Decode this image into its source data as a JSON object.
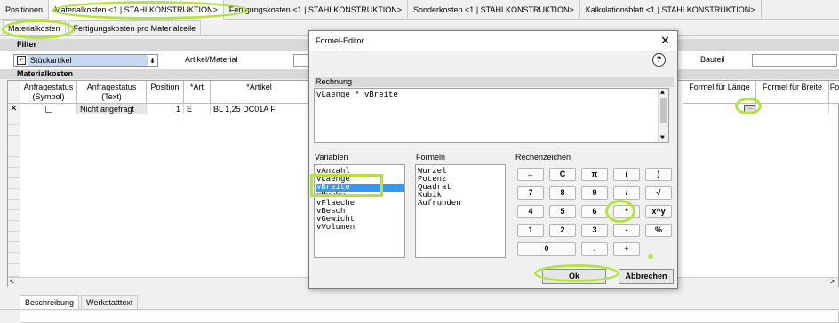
{
  "top_tabs": [
    "Positionen",
    "Materialkosten <1 | STAHLKONSTRUKTION>",
    "Fertigungskosten <1 | STAHLKONSTRUKTION>",
    "Sonderkosten <1 | STAHLKONSTRUKTION>",
    "Kalkulationsblatt <1 | STAHLKONSTRUKTION>"
  ],
  "sub_tabs": [
    "Materialkosten",
    "Fertigungskosten pro Materialzeile"
  ],
  "filter": {
    "title": "Filter",
    "select_value": "Stückartikel",
    "artikel_label": "Artikel/Material",
    "bauteil_label": "Bauteil"
  },
  "section_title": "Materialkosten",
  "grid": {
    "headers": [
      "Anfragestatus\n(Symbol)",
      "Anfragestatus\n(Text)",
      "Position",
      "*Art",
      "*Artikel",
      "Formel für Länge",
      "Formel für Breite",
      "Fo"
    ],
    "row": {
      "marker": "✕",
      "status_text": "Nicht angefragt",
      "position": "1",
      "art": "E",
      "artikel": "BL 1,25 DC01A F"
    },
    "scroll_left": "<",
    "scroll_right": ">"
  },
  "bottom_tabs": [
    "Beschreibung",
    "Werkstatttext"
  ],
  "dialog": {
    "title": "Formel-Editor",
    "close": "✕",
    "help": "?",
    "rechnung_label": "Rechnung",
    "formula": "vLaenge * vBreite",
    "variablen_label": "Variablen",
    "formeln_label": "Formeln",
    "rechenzeichen_label": "Rechenzeichen",
    "variablen": [
      "vAnzahl",
      "vLaenge",
      "vBreite",
      "vHoehe",
      "vFlaeche",
      "vBesch",
      "vGewicht",
      "vVolumen"
    ],
    "selected_variable": "vBreite",
    "formeln": [
      "Wurzel",
      "Potenz",
      "Quadrat",
      "Kubik",
      "Aufrunden"
    ],
    "keys": [
      [
        "←",
        "C",
        "π",
        "(",
        ")"
      ],
      [
        "7",
        "8",
        "9",
        "/",
        "√"
      ],
      [
        "4",
        "5",
        "6",
        "*",
        "x^y"
      ],
      [
        "1",
        "2",
        "3",
        "-",
        "%"
      ],
      [
        "0",
        ".",
        "+"
      ]
    ],
    "ok_label": "Ok",
    "cancel_label": "Abbrechen"
  }
}
